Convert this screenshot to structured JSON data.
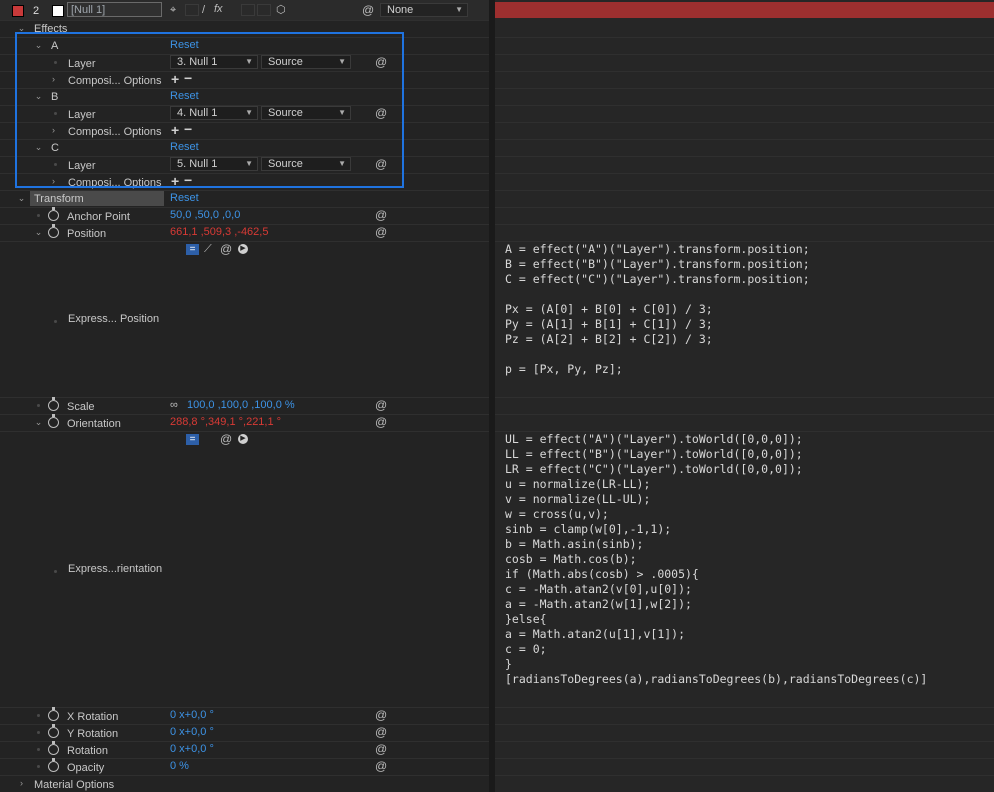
{
  "layer": {
    "number": "2",
    "name": "[Null 1]",
    "label_color": "#c83a3a",
    "parent_value": "None"
  },
  "effects": {
    "label": "Effects",
    "items": [
      {
        "name": "A",
        "reset": "Reset",
        "layer_label": "Layer",
        "layer_value": "3. Null 1",
        "source_value": "Source",
        "options_label": "Composi... Options"
      },
      {
        "name": "B",
        "reset": "Reset",
        "layer_label": "Layer",
        "layer_value": "4. Null 1",
        "source_value": "Source",
        "options_label": "Composi... Options"
      },
      {
        "name": "C",
        "reset": "Reset",
        "layer_label": "Layer",
        "layer_value": "5. Null 1",
        "source_value": "Source",
        "options_label": "Composi... Options"
      }
    ]
  },
  "transform": {
    "label": "Transform",
    "reset": "Reset",
    "anchor_point": {
      "label": "Anchor Point",
      "value": "50,0 ,50,0 ,0,0"
    },
    "position": {
      "label": "Position",
      "value": "661,1 ,509,3 ,-462,5"
    },
    "expr_position": {
      "label": "Express... Position"
    },
    "scale": {
      "label": "Scale",
      "value": "100,0 ,100,0 ,100,0 %"
    },
    "orientation": {
      "label": "Orientation",
      "value": "288,8 °,349,1 °,221,1 °"
    },
    "expr_orientation": {
      "label": "Express...rientation"
    },
    "x_rotation": {
      "label": "X Rotation",
      "value": "0 x+0,0 °"
    },
    "y_rotation": {
      "label": "Y Rotation",
      "value": "0 x+0,0 °"
    },
    "rotation": {
      "label": "Rotation",
      "value": "0 x+0,0 °"
    },
    "opacity": {
      "label": "Opacity",
      "value": "0 %"
    }
  },
  "material_options": {
    "label": "Material Options"
  },
  "expressions": {
    "position": "A = effect(\"A\")(\"Layer\").transform.position;\nB = effect(\"B\")(\"Layer\").transform.position;\nC = effect(\"C\")(\"Layer\").transform.position;\n\nPx = (A[0] + B[0] + C[0]) / 3;\nPy = (A[1] + B[1] + C[1]) / 3;\nPz = (A[2] + B[2] + C[2]) / 3;\n\np = [Px, Py, Pz];",
    "orientation": "UL = effect(\"A\")(\"Layer\").toWorld([0,0,0]);\nLL = effect(\"B\")(\"Layer\").toWorld([0,0,0]);\nLR = effect(\"C\")(\"Layer\").toWorld([0,0,0]);\nu = normalize(LR-LL);\nv = normalize(LL-UL);\nw = cross(u,v);\nsinb = clamp(w[0],-1,1);\nb = Math.asin(sinb);\ncosb = Math.cos(b);\nif (Math.abs(cosb) > .0005){\nc = -Math.atan2(v[0],u[0]);\na = -Math.atan2(w[1],w[2]);\n}else{\na = Math.atan2(u[1],v[1]);\nc = 0;\n}\n[radiansToDegrees(a),radiansToDegrees(b),radiansToDegrees(c)]"
  },
  "icons": {
    "stopwatch": "stopwatch-icon",
    "spiral": "expression-pickwhip-icon",
    "chain": "link-icon",
    "equals": "enable-expression-icon",
    "graph": "graph-icon",
    "play": "language-menu-icon"
  }
}
